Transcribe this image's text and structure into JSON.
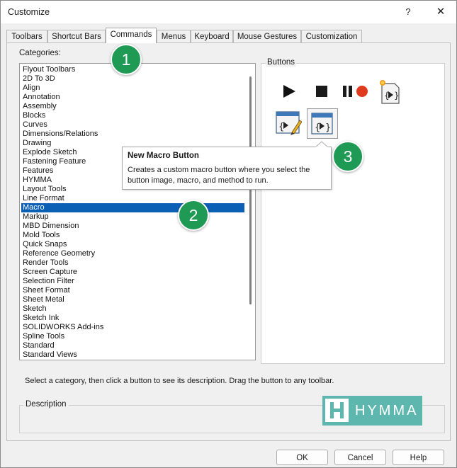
{
  "window": {
    "title": "Customize",
    "help_glyph": "?",
    "close_glyph": "✕"
  },
  "tabs": [
    {
      "label": "Toolbars"
    },
    {
      "label": "Shortcut Bars"
    },
    {
      "label": "Commands",
      "active": true
    },
    {
      "label": "Menus"
    },
    {
      "label": "Keyboard"
    },
    {
      "label": "Mouse Gestures"
    },
    {
      "label": "Customization"
    }
  ],
  "categories": {
    "label": "Categories:",
    "selected": "Macro",
    "items": [
      "Flyout Toolbars",
      "2D To 3D",
      "Align",
      "Annotation",
      "Assembly",
      "Blocks",
      "Curves",
      "Dimensions/Relations",
      "Drawing",
      "Explode Sketch",
      "Fastening Feature",
      "Features",
      "HYMMA",
      "Layout Tools",
      "Line Format",
      "Macro",
      "Markup",
      "MBD Dimension",
      "Mold Tools",
      "Quick Snaps",
      "Reference Geometry",
      "Render Tools",
      "Screen Capture",
      "Selection Filter",
      "Sheet Format",
      "Sheet Metal",
      "Sketch",
      "Sketch Ink",
      "SOLIDWORKS Add-ins",
      "Spline Tools",
      "Standard",
      "Standard Views"
    ]
  },
  "buttons_panel": {
    "label": "Buttons",
    "icons": [
      "play-macro-icon",
      "stop-macro-icon",
      "record-pause-macro-icon",
      "new-macro-icon",
      "edit-macro-icon",
      "new-macro-button-icon"
    ]
  },
  "tooltip": {
    "title": "New Macro Button",
    "body": "Creates a custom macro button where you select the button image, macro, and method to run."
  },
  "hint": "Select a category, then click a button to see its description. Drag the button to any toolbar.",
  "description": {
    "label": "Description"
  },
  "footer": {
    "ok": "OK",
    "cancel": "Cancel",
    "help": "Help"
  },
  "badges": [
    "1",
    "2",
    "3"
  ],
  "logo": {
    "text": "HYMMA"
  },
  "colors": {
    "selection": "#0b5fb4",
    "badge": "#1f9a55",
    "logo": "#5db7ae",
    "record": "#e03a1e"
  }
}
